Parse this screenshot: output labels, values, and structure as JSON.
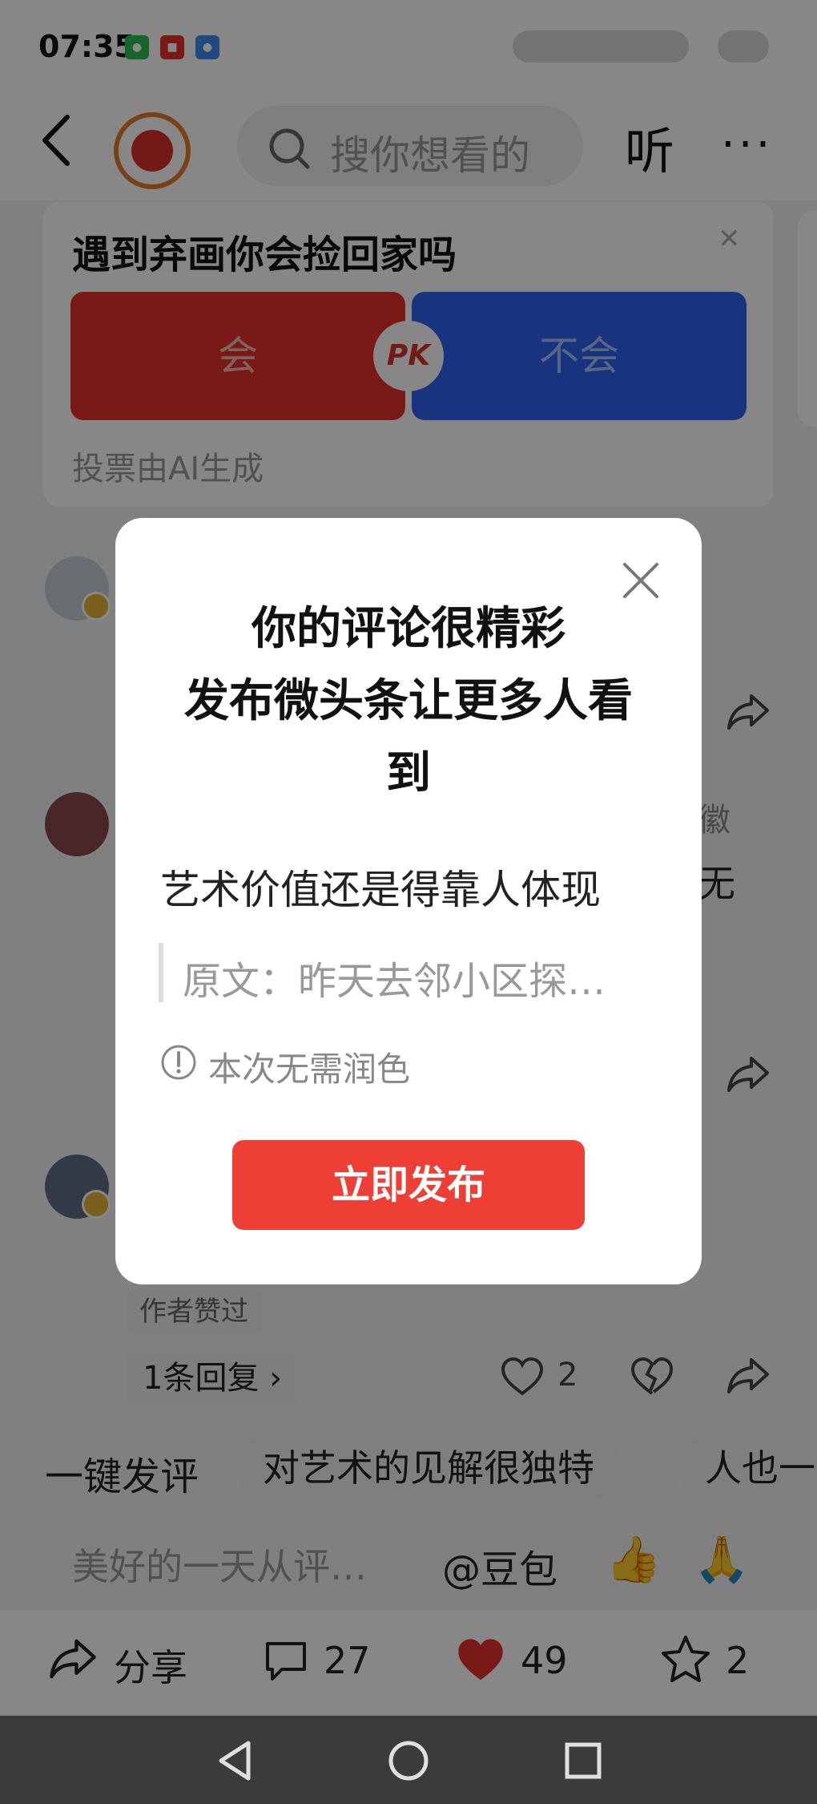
{
  "status_bar": {
    "time": "07:35"
  },
  "header": {
    "search_placeholder": "搜你想看的",
    "listen_label": "听",
    "more_label": "···"
  },
  "poll": {
    "question": "遇到弃画你会捡回家吗",
    "option_a": "会",
    "option_b": "不会",
    "vs_label": "PK",
    "note": "投票由AI生成"
  },
  "comments": {
    "side_fragment_1": "徽",
    "side_fragment_2": "无",
    "author_tag": "作者赞过",
    "reply_label": "1条回复 ›",
    "like_count": "2"
  },
  "suggestions": {
    "onekey_label": "一键发评",
    "chips": [
      "对艺术的见解很独特",
      "人也一"
    ]
  },
  "comment_input": {
    "placeholder": "美好的一天从评…",
    "mention": "@豆包",
    "emoji_1": "👍",
    "emoji_2": "🙏"
  },
  "action_bar": {
    "share_label": "分享",
    "comment_count": "27",
    "like_count": "49",
    "favorite_count": "2"
  },
  "modal": {
    "title_line1": "你的评论很精彩",
    "title_line2": "发布微头条让更多人看",
    "title_line3": "到",
    "comment_text": "艺术价值还是得靠人体现",
    "quote_text": "原文：昨天去邻小区探…",
    "info_text": "本次无需润色",
    "publish_label": "立即发布"
  },
  "colors": {
    "accent_red": "#ee3f36",
    "poll_blue": "#2f63f0",
    "poll_red": "#e6312a"
  }
}
